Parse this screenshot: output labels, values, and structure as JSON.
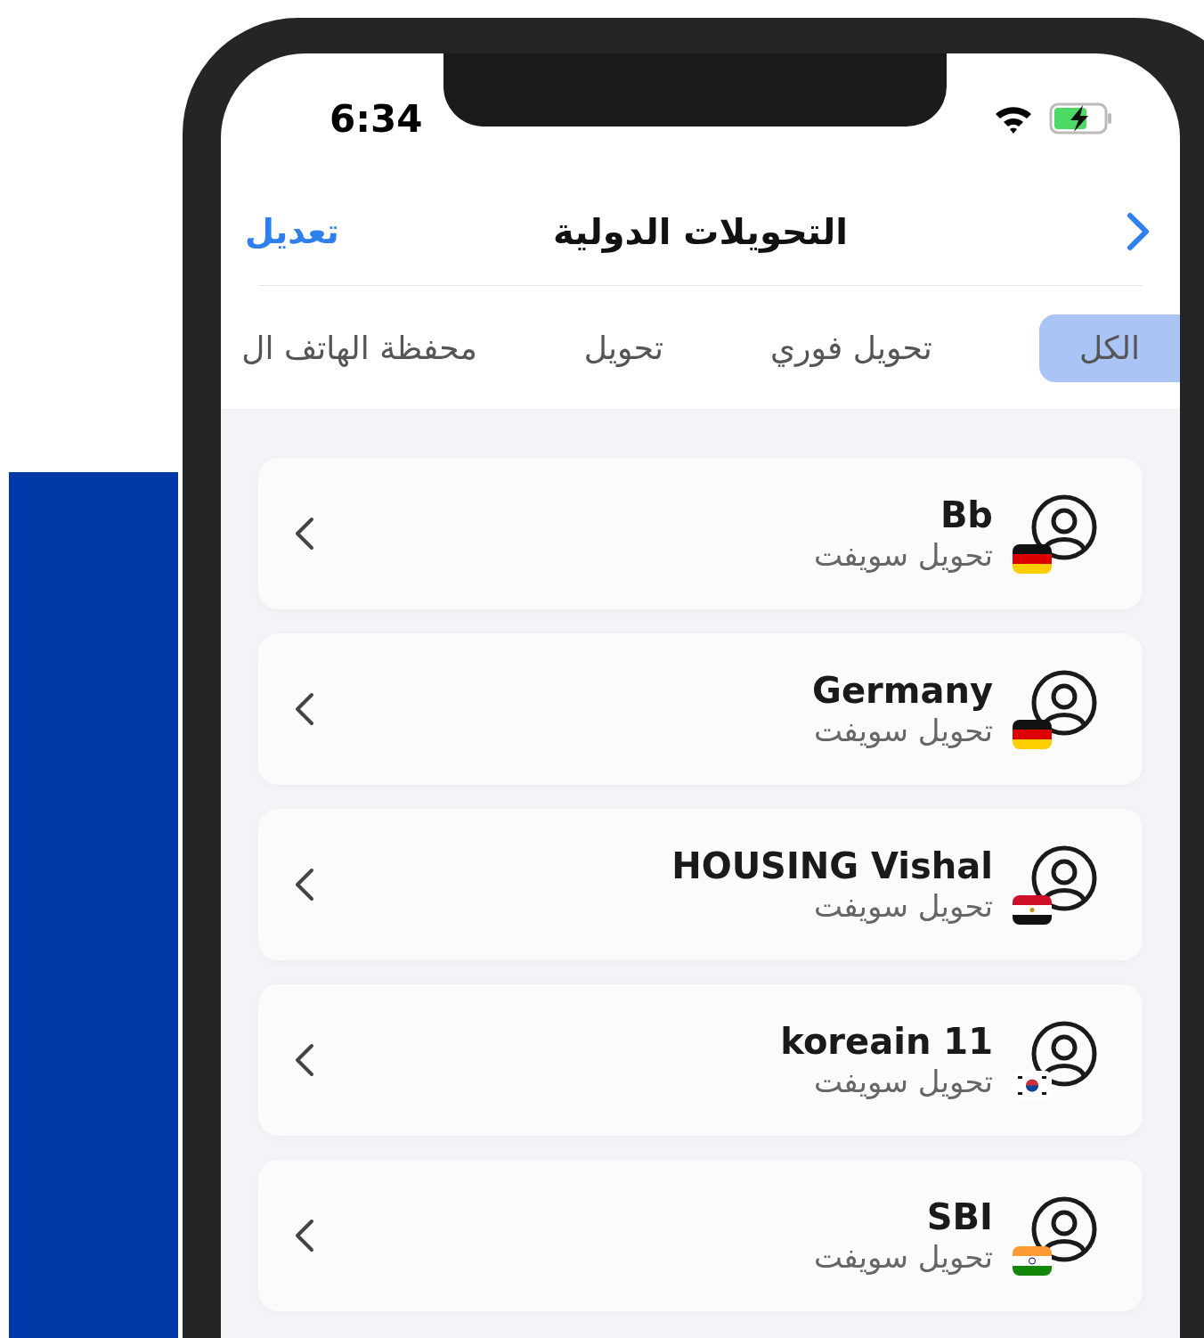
{
  "status_bar": {
    "time": "6:34"
  },
  "nav": {
    "title": "التحويلات الدولية",
    "edit": "تعديل"
  },
  "tabs": [
    {
      "label": "الكل",
      "selected": true
    },
    {
      "label": "تحويل فوري",
      "selected": false
    },
    {
      "label": "تحويل",
      "selected": false
    },
    {
      "label": "محفظة الهاتف ال",
      "selected": false
    }
  ],
  "beneficiaries": [
    {
      "name": "Bb",
      "type": "تحويل سويفت",
      "kind": "de"
    },
    {
      "name": "Germany",
      "type": "تحويل سويفت",
      "kind": "de"
    },
    {
      "name": "HOUSING Vishal",
      "type": "تحويل سويفت",
      "kind": "eg"
    },
    {
      "name": "koreain 11",
      "type": "تحويل سويفت",
      "kind": "kr"
    },
    {
      "name": "SBI",
      "type": "تحويل سويفت",
      "kind": "in"
    }
  ]
}
